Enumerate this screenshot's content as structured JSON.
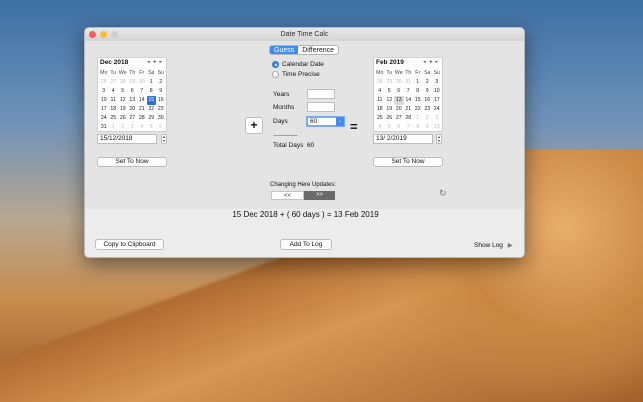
{
  "window": {
    "title": "Date Time Calc"
  },
  "tabs": [
    {
      "label": "Guess",
      "active": true
    },
    {
      "label": "Difference",
      "active": false
    }
  ],
  "left_calendar": {
    "month_label": "Dec 2018",
    "nav": "◂ ● ▸",
    "weekdays": [
      "Mo",
      "Tu",
      "We",
      "Th",
      "Fr",
      "Sa",
      "Su"
    ],
    "days": [
      {
        "d": "26",
        "dim": true
      },
      {
        "d": "27",
        "dim": true
      },
      {
        "d": "28",
        "dim": true
      },
      {
        "d": "29",
        "dim": true
      },
      {
        "d": "30",
        "dim": true
      },
      {
        "d": "1"
      },
      {
        "d": "2"
      },
      {
        "d": "3"
      },
      {
        "d": "4"
      },
      {
        "d": "5"
      },
      {
        "d": "6"
      },
      {
        "d": "7"
      },
      {
        "d": "8"
      },
      {
        "d": "9"
      },
      {
        "d": "10"
      },
      {
        "d": "11"
      },
      {
        "d": "12"
      },
      {
        "d": "13"
      },
      {
        "d": "14"
      },
      {
        "d": "15",
        "sel": true
      },
      {
        "d": "16"
      },
      {
        "d": "17"
      },
      {
        "d": "18"
      },
      {
        "d": "19"
      },
      {
        "d": "20"
      },
      {
        "d": "21"
      },
      {
        "d": "22"
      },
      {
        "d": "23"
      },
      {
        "d": "24"
      },
      {
        "d": "25"
      },
      {
        "d": "26"
      },
      {
        "d": "27"
      },
      {
        "d": "28"
      },
      {
        "d": "29"
      },
      {
        "d": "30"
      },
      {
        "d": "31"
      },
      {
        "d": "1",
        "dim": true
      },
      {
        "d": "2",
        "dim": true
      },
      {
        "d": "3",
        "dim": true
      },
      {
        "d": "4",
        "dim": true
      },
      {
        "d": "5",
        "dim": true
      },
      {
        "d": "6",
        "dim": true
      }
    ],
    "date_value": "15/12/2018",
    "set_now_label": "Set To Now"
  },
  "right_calendar": {
    "month_label": "Feb 2019",
    "nav": "◂ ● ▸",
    "weekdays": [
      "Mo",
      "Tu",
      "We",
      "Th",
      "Fr",
      "Sa",
      "Su"
    ],
    "days": [
      {
        "d": "28",
        "dim": true
      },
      {
        "d": "29",
        "dim": true
      },
      {
        "d": "30",
        "dim": true
      },
      {
        "d": "31",
        "dim": true
      },
      {
        "d": "1"
      },
      {
        "d": "2"
      },
      {
        "d": "3"
      },
      {
        "d": "4"
      },
      {
        "d": "5"
      },
      {
        "d": "6"
      },
      {
        "d": "7"
      },
      {
        "d": "8"
      },
      {
        "d": "9"
      },
      {
        "d": "10"
      },
      {
        "d": "11"
      },
      {
        "d": "12"
      },
      {
        "d": "13",
        "today": true
      },
      {
        "d": "14"
      },
      {
        "d": "15"
      },
      {
        "d": "16"
      },
      {
        "d": "17"
      },
      {
        "d": "18"
      },
      {
        "d": "19"
      },
      {
        "d": "20"
      },
      {
        "d": "21"
      },
      {
        "d": "22"
      },
      {
        "d": "23"
      },
      {
        "d": "24"
      },
      {
        "d": "25"
      },
      {
        "d": "26"
      },
      {
        "d": "27"
      },
      {
        "d": "28"
      },
      {
        "d": "1",
        "dim": true
      },
      {
        "d": "2",
        "dim": true
      },
      {
        "d": "3",
        "dim": true
      },
      {
        "d": "4",
        "dim": true
      },
      {
        "d": "5",
        "dim": true
      },
      {
        "d": "6",
        "dim": true
      },
      {
        "d": "7",
        "dim": true
      },
      {
        "d": "8",
        "dim": true
      },
      {
        "d": "9",
        "dim": true
      },
      {
        "d": "10",
        "dim": true
      }
    ],
    "date_value": "13/  2/2019",
    "set_now_label": "Set To Now"
  },
  "mode": {
    "calendar_date": "Calendar Date",
    "time_precise": "Time Precise",
    "selected": "calendar_date"
  },
  "inputs": {
    "years_label": "Years",
    "years_value": "",
    "months_label": "Months",
    "months_value": "",
    "days_label": "Days",
    "days_value": "60"
  },
  "operator": "+",
  "equals": "=",
  "separator": "----------------",
  "total_days_label": "Total Days",
  "total_days_value": "60",
  "changing_label": "Changing Here Updates:",
  "left_arrow": "<<",
  "right_arrow": ">>",
  "result_text": "15 Dec 2018 + ( 60 days ) = 13 Feb 2019",
  "copy_label": "Copy to Clipboard",
  "add_log_label": "Add To Log",
  "show_log_label": "Show Log",
  "refresh_icon": "↻",
  "colors": {
    "accent": "#3d8df4",
    "selected_day": "#2f73d9"
  }
}
